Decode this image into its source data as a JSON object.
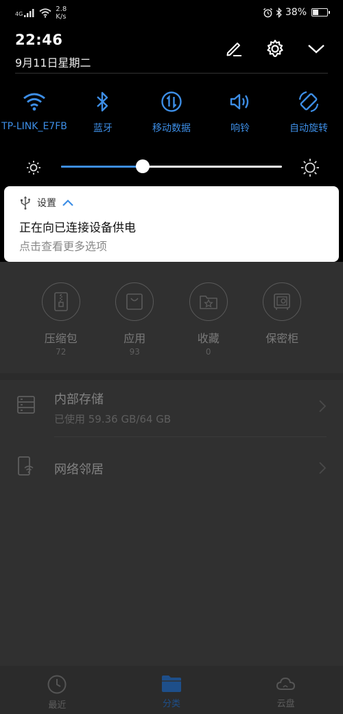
{
  "status_bar": {
    "network_type": "4G",
    "speed_value": "2.8",
    "speed_unit": "K/s",
    "battery": "38%",
    "battery_level": 0.38
  },
  "header": {
    "time": "22:46",
    "date": "9月11日星期二"
  },
  "quick_settings": [
    {
      "label": "TP-LINK_E7FB",
      "icon": "wifi-icon"
    },
    {
      "label": "蓝牙",
      "icon": "bluetooth-icon"
    },
    {
      "label": "移动数据",
      "icon": "mobile-data-icon"
    },
    {
      "label": "响铃",
      "icon": "volume-icon"
    },
    {
      "label": "自动旋转",
      "icon": "auto-rotate-icon"
    }
  ],
  "brightness": {
    "level": 0.37
  },
  "notification": {
    "app_name": "设置",
    "title": "正在向已连接设备供电",
    "subtitle": "点击查看更多选项"
  },
  "categories": [
    {
      "name": "压缩包",
      "count": "72",
      "icon": "zip-icon"
    },
    {
      "name": "应用",
      "count": "93",
      "icon": "bag-icon"
    },
    {
      "name": "收藏",
      "count": "0",
      "icon": "star-folder-icon"
    },
    {
      "name": "保密柜",
      "count": "",
      "icon": "safe-icon"
    }
  ],
  "storage": {
    "title": "内部存储",
    "detail": "已使用 59.36 GB/64 GB"
  },
  "network": {
    "title": "网络邻居"
  },
  "bottom_nav": [
    {
      "label": "最近",
      "icon": "clock-icon"
    },
    {
      "label": "分类",
      "icon": "folder-icon",
      "active": true
    },
    {
      "label": "云盘",
      "icon": "cloud-icon"
    }
  ],
  "colors": {
    "accent": "#3d8ee6",
    "shade_bg": "#000000",
    "dimmed_bg": "#303030"
  }
}
